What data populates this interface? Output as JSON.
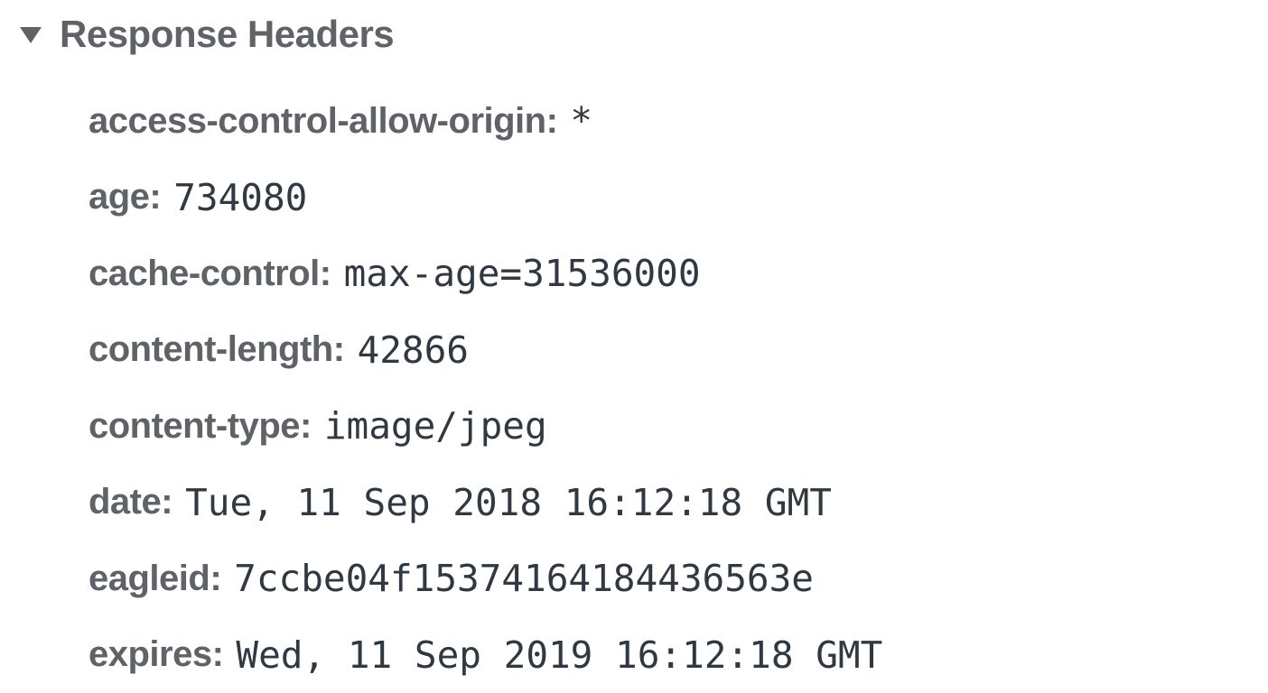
{
  "section": {
    "title": "Response Headers",
    "expanded": true,
    "toggle_icon": "triangle-down-icon"
  },
  "headers": [
    {
      "name": "access-control-allow-origin:",
      "value": "*"
    },
    {
      "name": "age:",
      "value": "734080"
    },
    {
      "name": "cache-control:",
      "value": "max-age=31536000"
    },
    {
      "name": "content-length:",
      "value": "42866"
    },
    {
      "name": "content-type:",
      "value": "image/jpeg"
    },
    {
      "name": "date:",
      "value": "Tue, 11 Sep 2018 16:12:18 GMT"
    },
    {
      "name": "eagleid:",
      "value": "7ccbe04f15374164184436563e"
    },
    {
      "name": "expires:",
      "value": "Wed, 11 Sep 2019 16:12:18 GMT"
    }
  ],
  "colors": {
    "header_name": "#5f6368",
    "header_value": "#303942",
    "background": "#ffffff"
  }
}
